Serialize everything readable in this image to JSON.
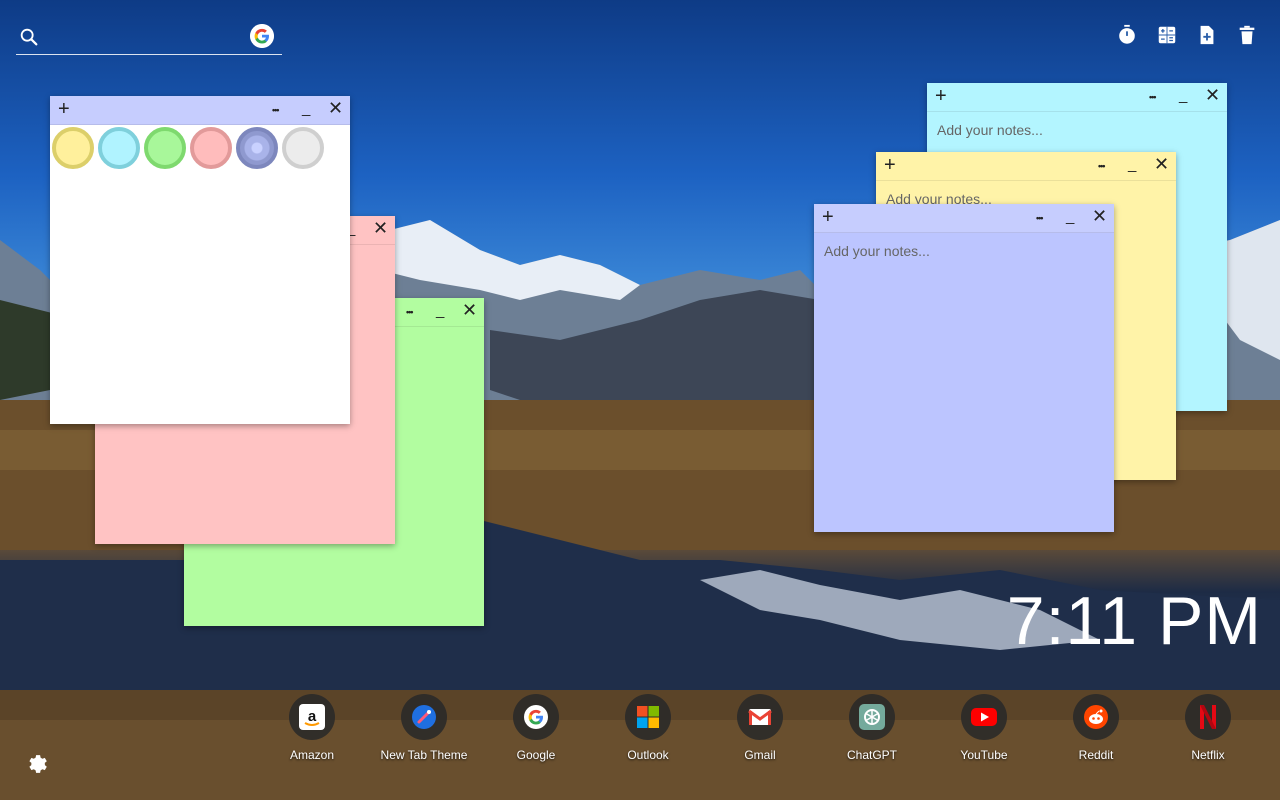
{
  "search": {
    "placeholder": "",
    "value": ""
  },
  "toolbar": {
    "icons": [
      "timer-icon",
      "calculator-icon",
      "new-note-icon",
      "trash-icon"
    ]
  },
  "notes": [
    {
      "color": "#b3f5ff",
      "header": "#b3f5ff",
      "placeholder": "Add your notes..."
    },
    {
      "color": "#fff3a8",
      "header": "#fff3a8",
      "placeholder": "Add your notes..."
    },
    {
      "color": "#bcc5ff",
      "header": "#c6cdfe",
      "placeholder": "Add your notes..."
    },
    {
      "color": "#ffc3c3",
      "header": "#ffc3c3",
      "placeholder": ""
    },
    {
      "color": "#b2fda0",
      "header": "#b2fda0",
      "placeholder": ""
    },
    {
      "color": "#ffffff",
      "header": "#c6cdfe",
      "placeholder": ""
    }
  ],
  "palette": [
    "#fff09c",
    "#b0f3ff",
    "#a8f79a",
    "#ffbcbc",
    "#a9b3e9",
    "#ececec"
  ],
  "clock": {
    "time": "7:11 PM"
  },
  "shortcuts": [
    {
      "label": "Amazon",
      "icon": "amazon-icon"
    },
    {
      "label": "New Tab Theme",
      "icon": "new-tab-theme-icon"
    },
    {
      "label": "Google",
      "icon": "google-icon"
    },
    {
      "label": "Outlook",
      "icon": "outlook-icon"
    },
    {
      "label": "Gmail",
      "icon": "gmail-icon"
    },
    {
      "label": "ChatGPT",
      "icon": "chatgpt-icon"
    },
    {
      "label": "YouTube",
      "icon": "youtube-icon"
    },
    {
      "label": "Reddit",
      "icon": "reddit-icon"
    },
    {
      "label": "Netflix",
      "icon": "netflix-icon"
    }
  ],
  "glyphs": {
    "plus": "+",
    "dots": "•••",
    "minimize": "_",
    "close": "✕"
  }
}
